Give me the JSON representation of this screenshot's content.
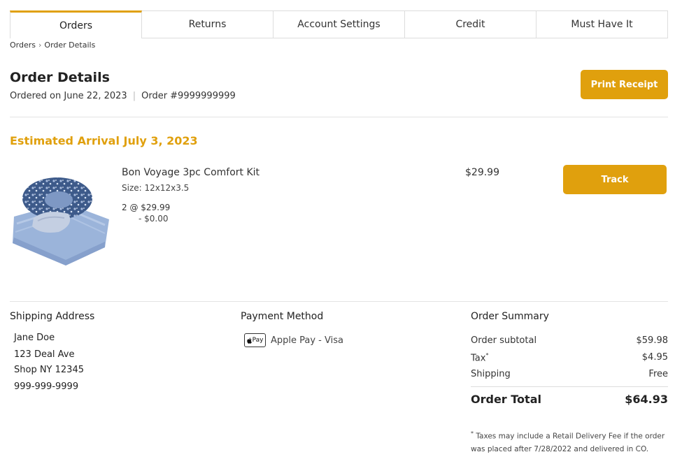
{
  "tabs": [
    {
      "label": "Orders",
      "active": true
    },
    {
      "label": "Returns",
      "active": false
    },
    {
      "label": "Account Settings",
      "active": false
    },
    {
      "label": "Credit",
      "active": false
    },
    {
      "label": "Must Have It",
      "active": false
    }
  ],
  "breadcrumb": {
    "parent": "Orders",
    "separator": "›",
    "current": "Order Details"
  },
  "page": {
    "title": "Order Details",
    "ordered_on": "Ordered on June 22, 2023",
    "order_number": "Order #9999999999",
    "print_label": "Print Receipt",
    "estimated_arrival": "Estimated Arrival July 3, 2023"
  },
  "product": {
    "name": "Bon Voyage 3pc Comfort Kit",
    "size": "Size: 12x12x3.5",
    "qty_price": "2 @ $29.99",
    "discount": "- $0.00",
    "price": "$29.99",
    "track_label": "Track"
  },
  "shipping": {
    "title": "Shipping Address",
    "name": "Jane Doe",
    "street": "123 Deal Ave",
    "city": "Shop NY 12345",
    "phone": "999-999-9999"
  },
  "payment": {
    "title": "Payment Method",
    "badge": "Pay",
    "method": "Apple Pay - Visa"
  },
  "summary": {
    "title": "Order Summary",
    "subtotal_label": "Order subtotal",
    "subtotal": "$59.98",
    "tax_label": "Tax",
    "tax_mark": "*",
    "tax": "$4.95",
    "shipping_label": "Shipping",
    "shipping": "Free",
    "total_label": "Order Total",
    "total": "$64.93",
    "footnote_mark": "*",
    "footnote": "Taxes may include a Retail Delivery Fee if the order was placed after 7/28/2022 and delivered in CO."
  },
  "colors": {
    "accent": "#e0a00d"
  }
}
